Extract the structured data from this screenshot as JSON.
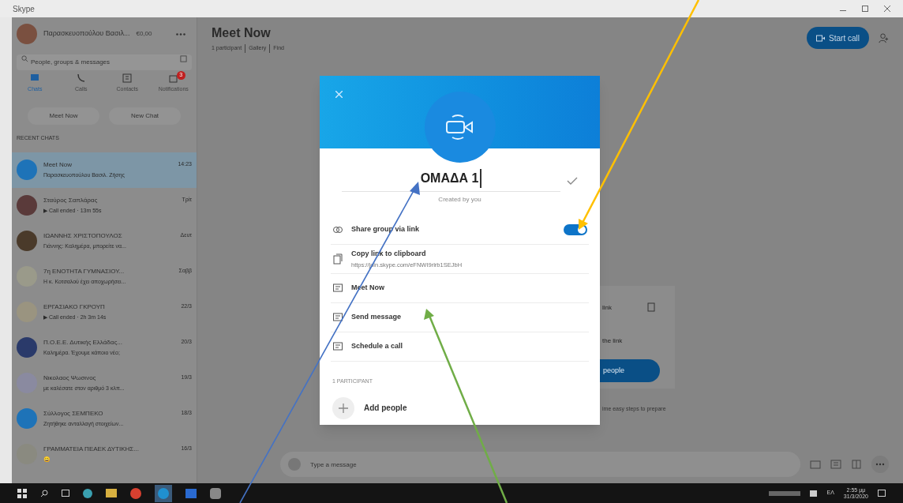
{
  "window": {
    "title": "Skype"
  },
  "profile": {
    "name": "Παρασκευοπούλου Βασιλ...",
    "credit": "€0,00"
  },
  "search": {
    "placeholder": "People, groups & messages"
  },
  "nav": [
    {
      "label": "Chats",
      "selected": true
    },
    {
      "label": "Calls",
      "selected": false
    },
    {
      "label": "Contacts",
      "selected": false
    },
    {
      "label": "Notifications",
      "selected": false,
      "badge": "3"
    }
  ],
  "actions": [
    "Meet Now",
    "New Chat"
  ],
  "recent_heading": "RECENT CHATS",
  "chats": [
    {
      "name": "Meet Now",
      "time": "14:23",
      "preview": "Παρασκευοπούλου Βασιλ. Ζήσης",
      "selected": true,
      "color": "#1e73b8"
    },
    {
      "name": "Σταύρος Σαπλάρας",
      "time": "Τρίτ",
      "preview": "▶ Call ended · 13m 55s",
      "selected": false,
      "color": "#5a3a3a"
    },
    {
      "name": "ΙΩΑΝΝΗΣ ΧΡΙΣΤΟΠΟΥΛΟΣ",
      "time": "Δευτ",
      "preview": "Γιάννης: Καλημέρα, μπορείτε να...",
      "selected": false,
      "color": "#4a3a2a"
    },
    {
      "name": "7η ΕΝΟΤΗΤΑ ΓΥΜΝΑΣΙΟΥ...",
      "time": "Σαββ",
      "preview": "Η κ. Κοτσαλού έχει αποχωρήσει...",
      "selected": false,
      "color": "#9a9a8a"
    },
    {
      "name": "ΕΡΓΑΣΙΑΚΟ ΓΚΡΟΥΠ",
      "time": "22/3",
      "preview": "▶ Call ended · 2h 3m 14s",
      "selected": false,
      "color": "#9a9480"
    },
    {
      "name": "Π.Ο.Ε.Ε. Δυτικής Ελλάδας...",
      "time": "20/3",
      "preview": "Καλημέρα. Έχουμε κάποιο νέο;",
      "selected": false,
      "color": "#2a3a6a"
    },
    {
      "name": "Νικολαος Ψωσινος",
      "time": "19/3",
      "preview": "με καλέσατε στον αριθμό 3 κλπ...",
      "selected": false,
      "color": "#8a8aa0"
    },
    {
      "name": "Σύλλογος ΣΕΜΠΕΚΟ",
      "time": "18/3",
      "preview": "Ζητήθηκε ανταλλαγή στοιχείων...",
      "selected": false,
      "color": "#1e73b8"
    },
    {
      "name": "ΓΡΑΜΜΑΤΕΙΑ ΠΕΑΕΚ ΔΥΤΙΚΗΣ...",
      "time": "16/3",
      "preview": "😀",
      "selected": false,
      "color": "#8a8a80"
    }
  ],
  "conversation": {
    "title": "Meet Now",
    "participants": "1 participant",
    "gallery": "Gallery",
    "find": "Find",
    "start_call": "Start call",
    "composer_placeholder": "Type a message"
  },
  "background_card": {
    "line_1": "link",
    "line_2": "the link",
    "button": "people",
    "note": "ime easy steps to prepare"
  },
  "dialog": {
    "group_name": "ΟΜΑΔΑ 1",
    "subtitle": "Created by you",
    "items": [
      {
        "kind": "toggle",
        "label": "Share group via link",
        "on": true
      },
      {
        "kind": "link",
        "label": "Copy link to clipboard",
        "detail": "https://join.skype.com/eFNWI9rlrb1SEJbH"
      },
      {
        "kind": "action",
        "label": "Meet Now"
      },
      {
        "kind": "action",
        "label": "Send message"
      },
      {
        "kind": "action",
        "label": "Schedule a call"
      }
    ],
    "participants_heading": "1 PARTICIPANT",
    "add_people": "Add people"
  },
  "taskbar": {
    "time": "2:55 μμ",
    "date": "31/3/2020",
    "language": "ΕΛ"
  }
}
